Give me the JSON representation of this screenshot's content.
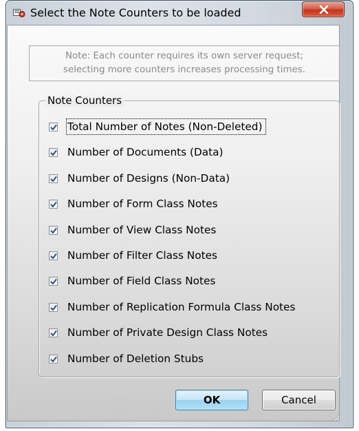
{
  "window": {
    "title": "Select the Note Counters to be loaded",
    "app_icon": "app-icon",
    "close_icon": "close-icon"
  },
  "note": {
    "line1": "Note: Each counter requires its own server request;",
    "line2": "selecting more counters increases processing times."
  },
  "group": {
    "legend": "Note Counters",
    "items": [
      {
        "label": "Total Number of Notes (Non-Deleted)",
        "checked": true
      },
      {
        "label": "Number of Documents (Data)",
        "checked": true
      },
      {
        "label": "Number of Designs (Non-Data)",
        "checked": true
      },
      {
        "label": "Number of Form Class Notes",
        "checked": true
      },
      {
        "label": "Number of View Class Notes",
        "checked": true
      },
      {
        "label": "Number of Filter Class Notes",
        "checked": true
      },
      {
        "label": "Number of Field Class Notes",
        "checked": true
      },
      {
        "label": "Number of Replication Formula Class Notes",
        "checked": true
      },
      {
        "label": "Number of Private Design Class Notes",
        "checked": true
      },
      {
        "label": "Number of Deletion Stubs",
        "checked": true
      }
    ]
  },
  "buttons": {
    "ok_label": "OK",
    "cancel_label": "Cancel"
  },
  "colors": {
    "close_button": "#c4341d",
    "ok_button_border": "#3c7fb1",
    "note_text": "#8a8a8a"
  }
}
